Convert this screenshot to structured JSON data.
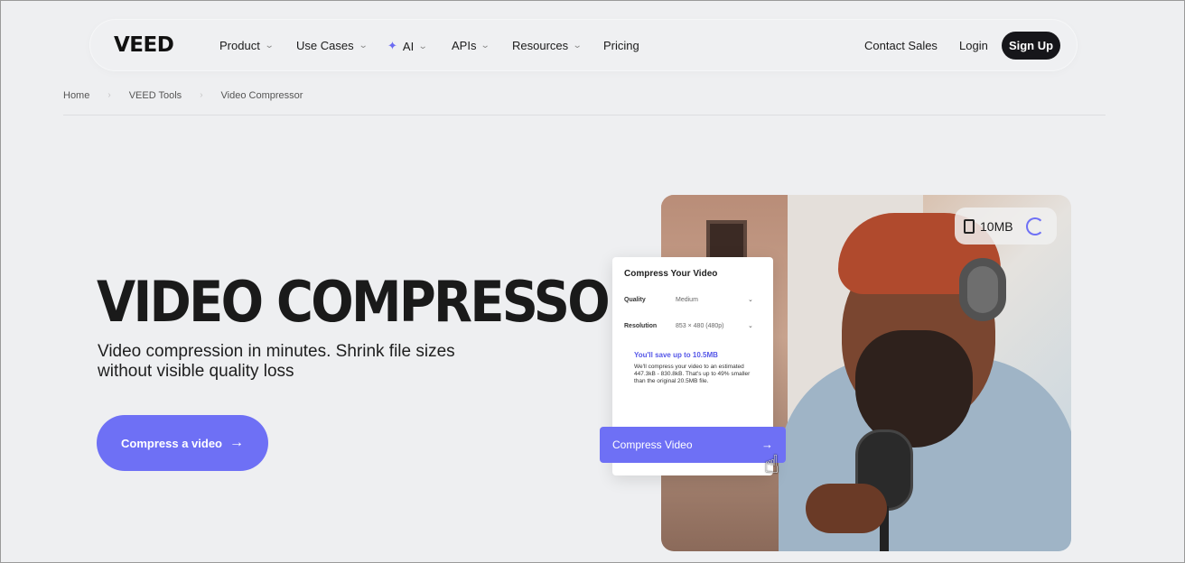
{
  "nav": {
    "logo": "VEED",
    "items": [
      {
        "label": "Product",
        "has_dropdown": true
      },
      {
        "label": "Use Cases",
        "has_dropdown": true
      },
      {
        "label": "AI",
        "has_dropdown": true,
        "icon": "sparkle-icon"
      },
      {
        "label": "APIs",
        "has_dropdown": true
      },
      {
        "label": "Resources",
        "has_dropdown": true
      },
      {
        "label": "Pricing",
        "has_dropdown": false
      }
    ],
    "contact_sales": "Contact Sales",
    "login": "Login",
    "signup": "Sign Up"
  },
  "breadcrumb": [
    "Home",
    "VEED Tools",
    "Video Compressor"
  ],
  "hero": {
    "title": "VIDEO COMPRESSOR",
    "subtitle": "Video compression in minutes. Shrink file sizes without visible quality loss",
    "cta": "Compress a video"
  },
  "preview": {
    "file_size": "10MB",
    "panel": {
      "title": "Compress Your Video",
      "quality_label": "Quality",
      "quality_value": "Medium",
      "resolution_label": "Resolution",
      "resolution_value": "853 × 480 (480p)",
      "save_title": "You'll save up to 10.5MB",
      "save_body": "We'll compress your video to an estimated 447.3kB - 830.8kB. That's up to 49% smaller than the original 20.5MB file."
    },
    "compress_button": "Compress Video"
  },
  "colors": {
    "accent": "#6e70f5",
    "signup_bg": "#16161a",
    "page_bg": "#eeeff1"
  }
}
